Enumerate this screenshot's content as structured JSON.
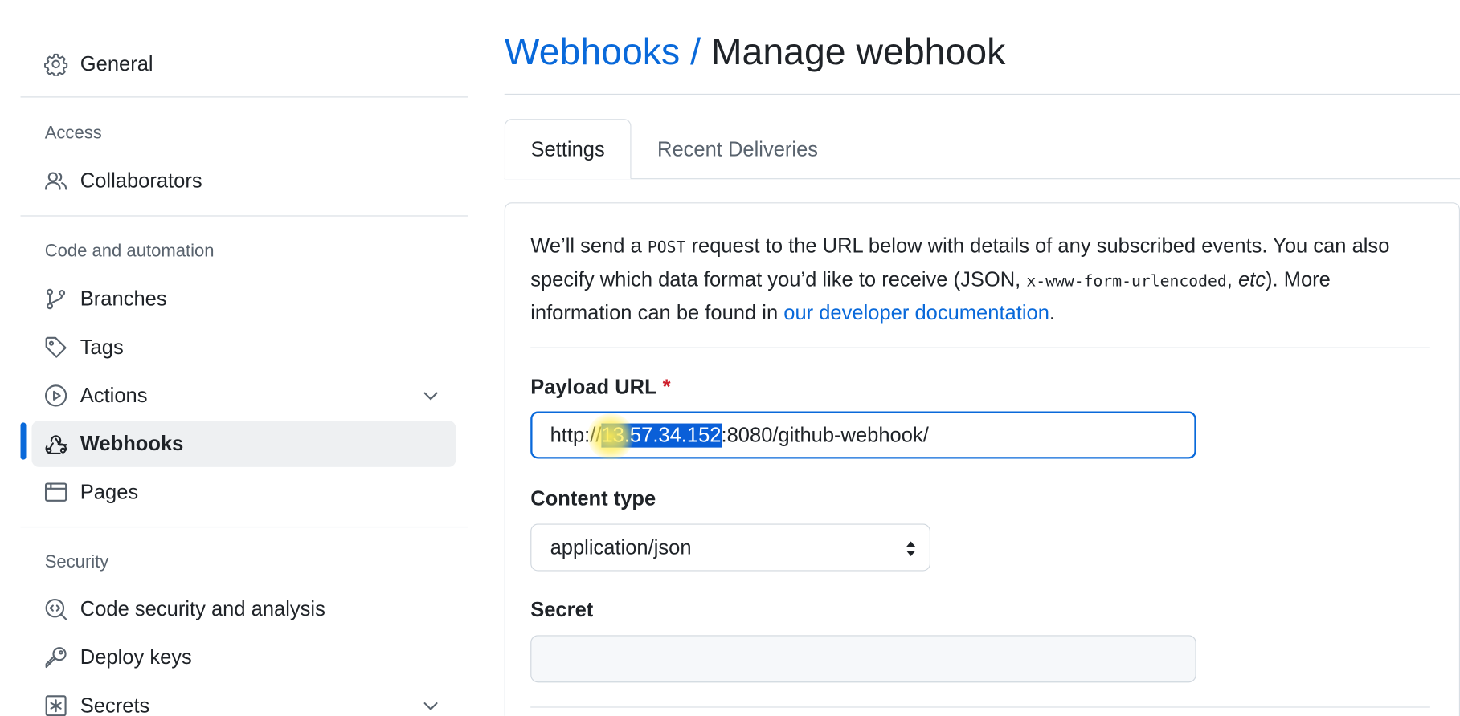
{
  "sidebar": {
    "general": {
      "label": "General",
      "icon": "gear-icon"
    },
    "sections": [
      {
        "heading": "Access"
      },
      {
        "heading": "Code and automation"
      },
      {
        "heading": "Security"
      }
    ],
    "items": {
      "collaborators": {
        "label": "Collaborators",
        "icon": "people-icon"
      },
      "branches": {
        "label": "Branches",
        "icon": "git-branch-icon"
      },
      "tags": {
        "label": "Tags",
        "icon": "tag-icon"
      },
      "actions": {
        "label": "Actions",
        "icon": "play-icon"
      },
      "webhooks": {
        "label": "Webhooks",
        "icon": "webhook-icon",
        "active": true
      },
      "pages": {
        "label": "Pages",
        "icon": "browser-icon"
      },
      "code_security": {
        "label": "Code security and analysis",
        "icon": "codescan-icon"
      },
      "deploy_keys": {
        "label": "Deploy keys",
        "icon": "key-icon"
      },
      "secrets": {
        "label": "Secrets",
        "icon": "asterisk-icon"
      }
    }
  },
  "header": {
    "crumb": "Webhooks",
    "separator": "/",
    "current": "Manage webhook"
  },
  "tabs": [
    {
      "label": "Settings",
      "selected": true
    },
    {
      "label": "Recent Deliveries",
      "selected": false
    }
  ],
  "intro": {
    "part1": "We’ll send a ",
    "code1": "POST",
    "part2": " request to the URL below with details of any subscribed events. You can also specify which data format you’d like to receive (JSON, ",
    "code2": "x-www-form-urlencoded",
    "part3": ", ",
    "etc": "etc",
    "part4": "). More information can be found in ",
    "link": "our developer documentation",
    "part5": "."
  },
  "form": {
    "payload_url": {
      "label": "Payload URL",
      "required_mark": "*",
      "value_prefix": "http://",
      "value_selected": "13.57.34.152",
      "value_suffix": ":8080/github-webhook/"
    },
    "content_type": {
      "label": "Content type",
      "value": "application/json"
    },
    "secret": {
      "label": "Secret",
      "value": ""
    }
  },
  "colors": {
    "accent": "#0969da",
    "selection": "#0a5fd8",
    "required": "#cf222e",
    "active_bg": "#eef0f2"
  }
}
